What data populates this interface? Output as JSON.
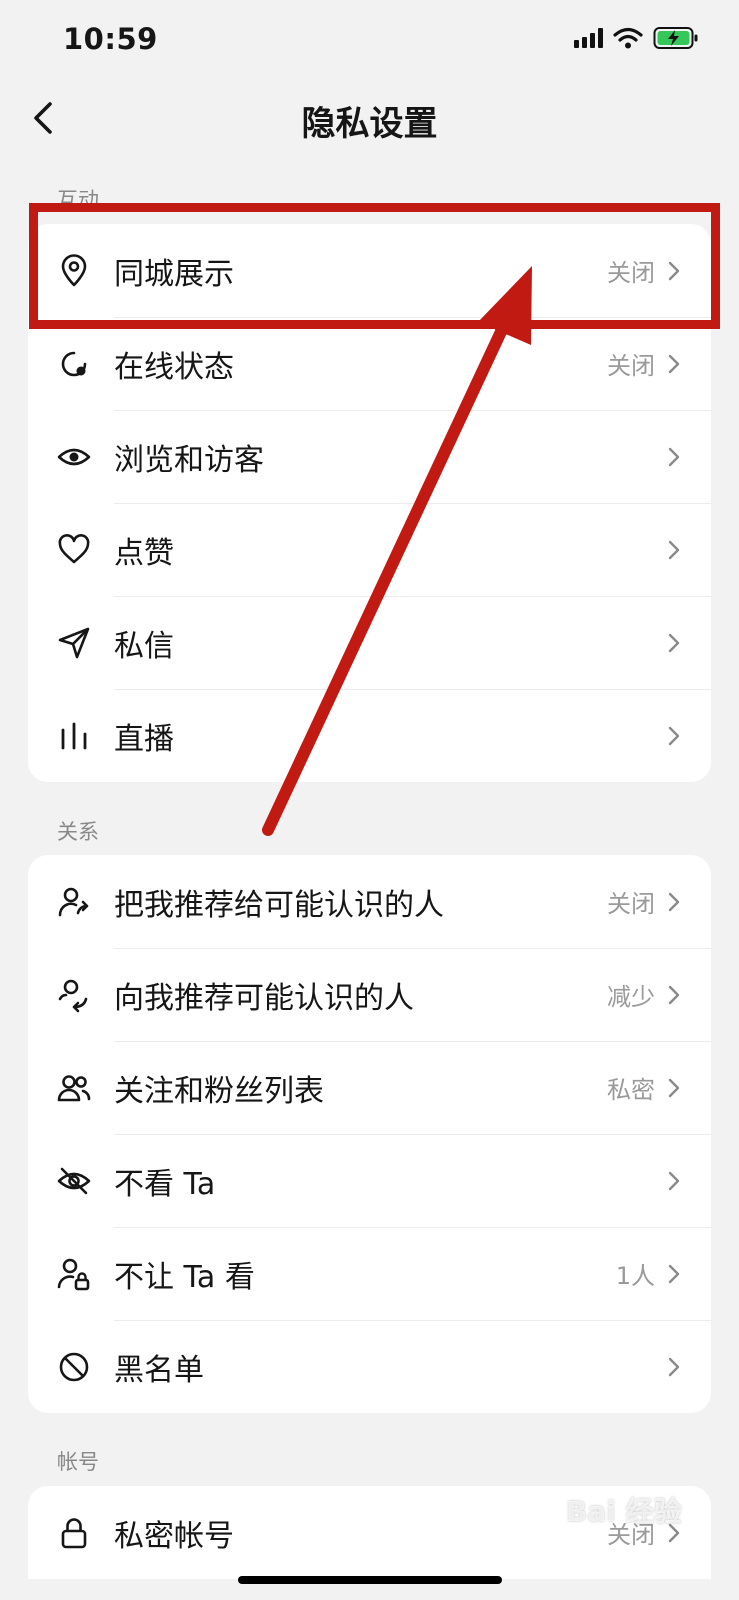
{
  "status": {
    "time": "10:59"
  },
  "nav": {
    "title": "隐私设置"
  },
  "sections": [
    {
      "label": "互动",
      "items": [
        {
          "label": "同城展示",
          "value": "关闭",
          "icon": "location-pin-icon"
        },
        {
          "label": "在线状态",
          "value": "关闭",
          "icon": "online-status-icon"
        },
        {
          "label": "浏览和访客",
          "value": "",
          "icon": "eye-icon"
        },
        {
          "label": "点赞",
          "value": "",
          "icon": "heart-icon"
        },
        {
          "label": "私信",
          "value": "",
          "icon": "send-icon"
        },
        {
          "label": "直播",
          "value": "",
          "icon": "bars-icon"
        }
      ]
    },
    {
      "label": "关系",
      "items": [
        {
          "label": "把我推荐给可能认识的人",
          "value": "关闭",
          "icon": "user-share-icon"
        },
        {
          "label": "向我推荐可能认识的人",
          "value": "减少",
          "icon": "user-recommend-icon"
        },
        {
          "label": "关注和粉丝列表",
          "value": "私密",
          "icon": "users-icon"
        },
        {
          "label": "不看 Ta",
          "value": "",
          "icon": "eye-off-icon"
        },
        {
          "label": "不让 Ta 看",
          "value": "1人",
          "icon": "user-lock-icon"
        },
        {
          "label": "黑名单",
          "value": "",
          "icon": "block-icon"
        }
      ]
    },
    {
      "label": "帐号",
      "items": [
        {
          "label": "私密帐号",
          "value": "关闭",
          "icon": "lock-icon"
        }
      ]
    }
  ],
  "watermark": "Bai 经验",
  "colors": {
    "annotation": "#c11a13",
    "background": "#f2f2f2"
  }
}
